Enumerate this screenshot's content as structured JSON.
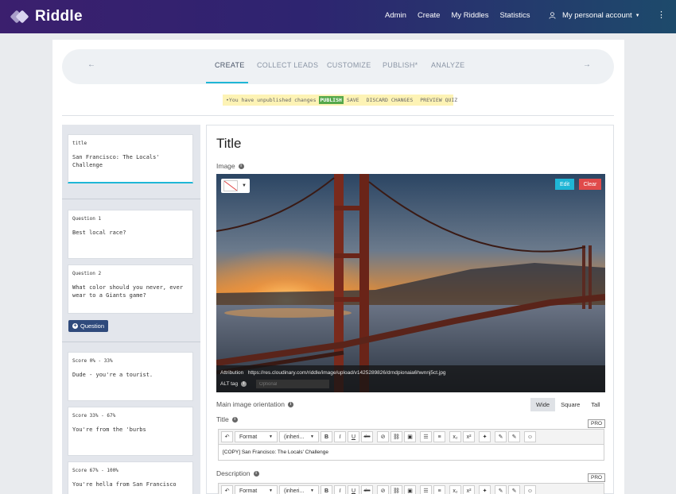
{
  "brand": {
    "name": "Riddle"
  },
  "nav": {
    "links": [
      "Admin",
      "Create",
      "My Riddles",
      "Statistics"
    ],
    "account_label": "My personal account"
  },
  "steps": {
    "items": [
      "CREATE",
      "COLLECT LEADS",
      "CUSTOMIZE",
      "PUBLISH*",
      "ANALYZE"
    ],
    "active": "CREATE",
    "prev_arrow": "←",
    "next_arrow": "→"
  },
  "notice": {
    "message": "•You have unpublished changes",
    "publish": "PUBLISH",
    "save": "SAVE",
    "discard": "DISCARD CHANGES",
    "preview": "PREVIEW QUIZ"
  },
  "sidebar": {
    "title_card": {
      "label": "title",
      "text": "San Francisco: The Locals' Challenge"
    },
    "questions": [
      {
        "label": "Question 1",
        "text": "Best local race?"
      },
      {
        "label": "Question 2",
        "text": "What color should you never, ever wear to a Giants game?"
      }
    ],
    "add_question_label": "Question",
    "results": [
      {
        "label": "Score 0% - 33%",
        "text": "Dude - you're a tourist."
      },
      {
        "label": "Score 33% - 67%",
        "text": "You're from the 'burbs"
      },
      {
        "label": "Score 67% - 100%",
        "text": "You're hella from San Francisco"
      }
    ]
  },
  "editor": {
    "heading": "Title",
    "image_label": "Image",
    "edit_label": "Edit",
    "clear_label": "Clear",
    "attribution_label": "Attribution",
    "attribution_url": "https://res.cloudinary.com/riddle/image/upload/v1425289826/drndpionaia6hwnnj5ct.jpg",
    "alt_label": "ALT tag",
    "alt_placeholder": "Optional",
    "orientation_label": "Main image orientation",
    "orientation_options": [
      "Wide",
      "Square",
      "Tall"
    ],
    "orientation_selected": "Wide",
    "title_label": "Title",
    "title_value": "[COPY] San Francisco: The Locals' Challenge",
    "description_label": "Description",
    "pro_badge": "PRO",
    "toolbar": {
      "format": "Format",
      "font": "(inheri...",
      "bold": "B",
      "italic": "I",
      "underline": "U",
      "strike": "abc",
      "subscript": "x₂",
      "superscript": "x²"
    }
  },
  "colors": {
    "accent": "#1fb6d6",
    "publish": "#55a84a",
    "clear": "#e04a4a",
    "nav_start": "#3b1f6e",
    "nav_end": "#1d4a6b"
  }
}
